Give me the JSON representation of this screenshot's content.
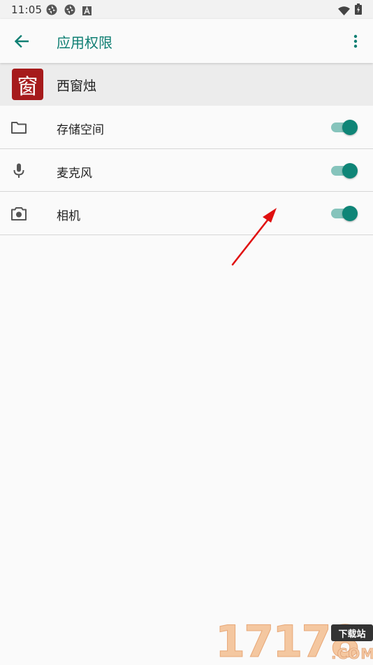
{
  "status_bar": {
    "time": "11:05",
    "left_icons": [
      "aperture-icon",
      "aperture-icon",
      "font-a-icon"
    ],
    "right_icons": [
      "wifi-icon",
      "battery-icon"
    ]
  },
  "app_bar": {
    "title": "应用权限",
    "back_icon": "arrow-back-icon",
    "menu_icon": "more-vert-icon",
    "title_color": "#0f7f73"
  },
  "app": {
    "name": "西窗烛",
    "logo_char": "窗",
    "logo_color": "#a61b1c"
  },
  "permissions": [
    {
      "label": "存储空间",
      "icon": "folder-icon",
      "enabled": true
    },
    {
      "label": "麦克风",
      "icon": "microphone-icon",
      "enabled": true
    },
    {
      "label": "相机",
      "icon": "camera-icon",
      "enabled": true
    }
  ],
  "toggle_color": "#0f8577",
  "annotation": {
    "type": "red-arrow",
    "color": "#e01010"
  },
  "watermark": {
    "digits": "17178",
    "tag": "下载站",
    "suffix": ".COM"
  }
}
